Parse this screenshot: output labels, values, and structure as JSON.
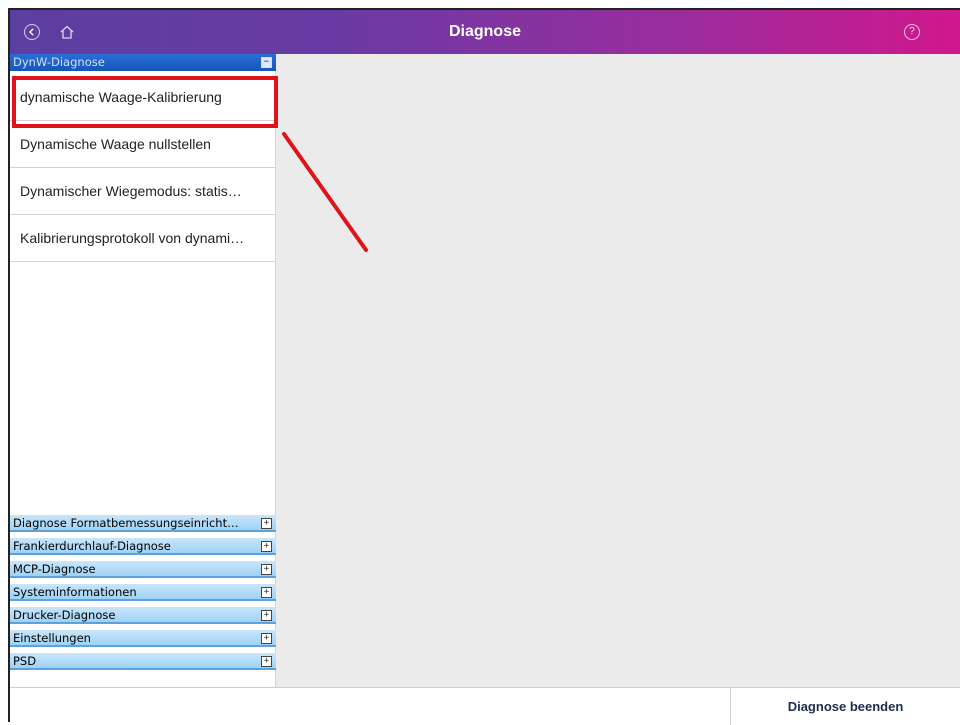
{
  "header": {
    "title": "Diagnose",
    "back_icon": "back-circle-icon",
    "home_icon": "home-icon",
    "help_icon": "help-circle-icon",
    "help_glyph": "?"
  },
  "sidebar": {
    "active_section": {
      "label": "DynW-Diagnose",
      "toggle": "−",
      "items": [
        {
          "label": "dynamische Waage-Kalibrierung"
        },
        {
          "label": "Dynamische Waage nullstellen"
        },
        {
          "label": "Dynamischer Wiegemodus: statis…"
        },
        {
          "label": "Kalibrierungsprotokoll von dynami…"
        }
      ]
    },
    "collapsed_sections": [
      {
        "label": "Diagnose Formatbemessungseinricht…",
        "toggle": "+"
      },
      {
        "label": "Frankierdurchlauf-Diagnose",
        "toggle": "+"
      },
      {
        "label": "MCP-Diagnose",
        "toggle": "+"
      },
      {
        "label": "Systeminformationen",
        "toggle": "+"
      },
      {
        "label": "Drucker-Diagnose",
        "toggle": "+"
      },
      {
        "label": "Einstellungen",
        "toggle": "+"
      },
      {
        "label": "PSD",
        "toggle": "+"
      }
    ]
  },
  "footer": {
    "exit_label": "Diagnose beenden"
  },
  "annotation": {
    "highlight_color": "#e0131b"
  },
  "colors": {
    "header_gradient_start": "#5b3fa0",
    "header_gradient_end": "#d0178c",
    "active_section": "#1656b8",
    "collapsed_section": "#9fd2f5",
    "content_bg": "#ebebeb"
  }
}
